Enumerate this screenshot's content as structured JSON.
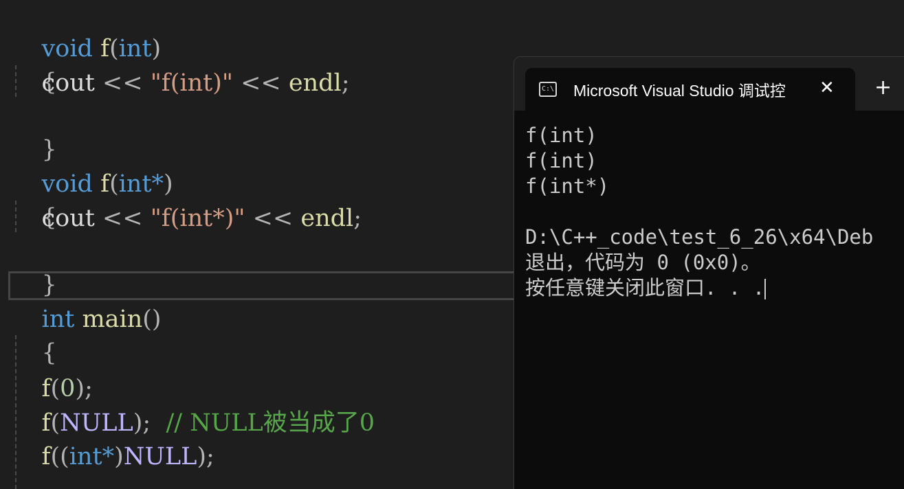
{
  "editor": {
    "lines": {
      "l1": {
        "kw": "void",
        "fn": "f",
        "p1": "(",
        "type": "int",
        "p2": ")"
      },
      "l2": {
        "brace": "{"
      },
      "l3": {
        "indent": "    ",
        "id": "cout",
        "op1": " << ",
        "str": "\"f(int)\"",
        "op2": " << ",
        "fn": "endl",
        "semi": ";"
      },
      "l4": {
        "brace": "}"
      },
      "l5": {
        "kw": "void",
        "fn": "f",
        "p1": "(",
        "type": "int*",
        "p2": ")"
      },
      "l6": {
        "brace": "{"
      },
      "l7": {
        "indent": "    ",
        "id": "cout",
        "op1": " << ",
        "str": "\"f(int*)\"",
        "op2": " << ",
        "fn": "endl",
        "semi": ";"
      },
      "l8": {
        "brace": "}"
      },
      "l9": {
        "type": "int",
        "fn": "main",
        "parens": "()"
      },
      "l10": {
        "brace": "{"
      },
      "l12": {
        "indent": "    ",
        "fn": "f",
        "p1": "(",
        "arg": "0",
        "p2": ");"
      },
      "l13": {
        "indent": "    ",
        "fn": "f",
        "p1": "(",
        "arg": "NULL",
        "p2": ");",
        "gap": "  ",
        "comment": "// NULL被当成了0"
      },
      "l14": {
        "indent": "    ",
        "fn": "f",
        "p1": "((",
        "type": "int*",
        "p2": ")",
        "arg": "NULL",
        "p3": ");"
      }
    }
  },
  "console": {
    "tab_title": "Microsoft Visual Studio 调试控",
    "tab_icon_text": "C:\\",
    "close_symbol": "✕",
    "new_tab_symbol": "+",
    "output": [
      "f(int)",
      "f(int)",
      "f(int*)",
      "",
      "D:\\C++_code\\test_6_26\\x64\\Deb",
      "退出，代码为 0 (0x0)。",
      "按任意键关闭此窗口. . ."
    ]
  }
}
